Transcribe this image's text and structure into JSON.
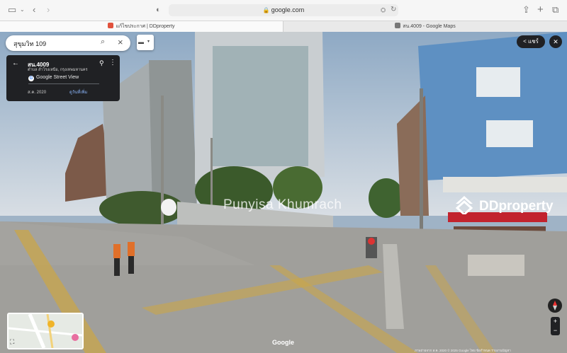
{
  "browser": {
    "url": "google.com",
    "tabs": [
      {
        "label": "แก้ไขประกาศ | DDproperty"
      },
      {
        "label": "สน.4009 - Google Maps"
      }
    ]
  },
  "search": {
    "query": "สุขุมวิท 109"
  },
  "info_card": {
    "title": "สน.4009",
    "subtitle": "ตำบล สำโรงเหนือ, กรุงเทพมหานคร",
    "provider": "Google Street View",
    "date": "ส.ค. 2020",
    "more_dates": "ดูวันที่เพิ่ม"
  },
  "share_label": "แชร์",
  "watermark_text": "Punyisa Khumrach",
  "brand": "DDproperty",
  "google_logo": "Google",
  "footer_text": "ภาพถ่ายจาก ส.ค. 2020   © 2025 Google   ไทย   ข้อกำหนด   รายงานปัญหา"
}
